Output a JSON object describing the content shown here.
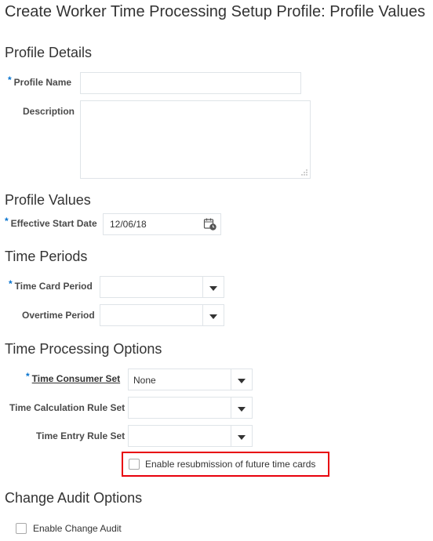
{
  "page_title": "Create Worker Time Processing Setup Profile: Profile Values",
  "profile_details": {
    "heading": "Profile Details",
    "profile_name_label": "Profile Name",
    "profile_name_value": "",
    "description_label": "Description",
    "description_value": ""
  },
  "profile_values": {
    "heading": "Profile Values",
    "effective_start_date_label": "Effective Start Date",
    "effective_start_date_value": "12/06/18"
  },
  "time_periods": {
    "heading": "Time Periods",
    "time_card_period_label": "Time Card Period",
    "time_card_period_value": "",
    "overtime_period_label": "Overtime Period",
    "overtime_period_value": ""
  },
  "time_processing_options": {
    "heading": "Time Processing Options",
    "time_consumer_set_label": "Time Consumer Set",
    "time_consumer_set_value": "None",
    "time_calculation_rule_set_label": "Time Calculation Rule Set",
    "time_calculation_rule_set_value": "",
    "time_entry_rule_set_label": "Time Entry Rule Set",
    "time_entry_rule_set_value": "",
    "enable_resubmission_label": "Enable resubmission of future time cards",
    "enable_resubmission_checked": false
  },
  "change_audit_options": {
    "heading": "Change Audit Options",
    "enable_change_audit_label": "Enable Change Audit",
    "enable_change_audit_checked": false
  },
  "required_marker": "*",
  "icons": {
    "calendar": "calendar-icon",
    "dropdown": "chevron-down-icon"
  },
  "colors": {
    "required_marker": "#0572ce",
    "highlight_border": "#e8000b"
  }
}
